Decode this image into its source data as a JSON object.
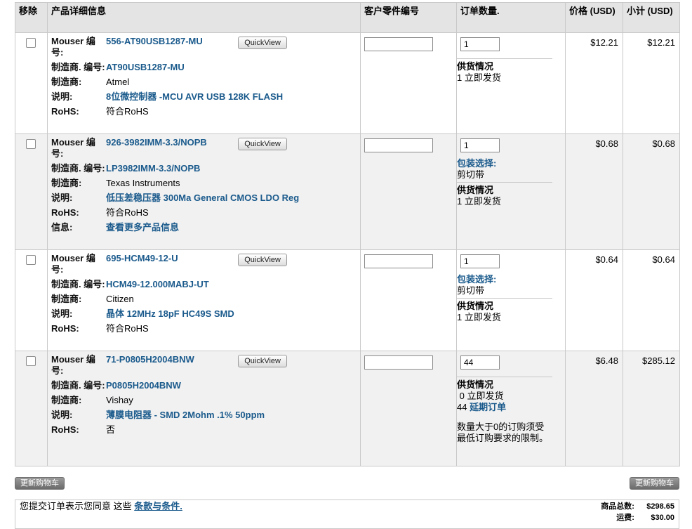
{
  "headers": {
    "remove": "移除",
    "details": "产品详细信息",
    "customer_part": "客户零件编号",
    "quantity": "订单数量.",
    "price": "价格 (USD)",
    "subtotal": "小计 (USD)"
  },
  "labels": {
    "mouser_no": "Mouser 编号:",
    "mfr_no": "制造商. 编号:",
    "mfr": "制造商:",
    "desc": "说明:",
    "rohs": "RoHS:",
    "info": "信息:",
    "quickview": "QuickView",
    "availability": "供货情况",
    "packaging": "包装选择:"
  },
  "items": [
    {
      "mouser_no": "556-AT90USB1287-MU",
      "mfr_no": "AT90USB1287-MU",
      "mfr": "Atmel",
      "desc": "8位微控制器 -MCU AVR USB 128K FLASH",
      "rohs": "符合RoHS",
      "customer_part": "",
      "qty": "1",
      "availability": "1 立即发货",
      "price": "$12.21",
      "subtotal": "$12.21"
    },
    {
      "mouser_no": "926-3982IMM-3.3/NOPB",
      "mfr_no": "LP3982IMM-3.3/NOPB",
      "mfr": "Texas Instruments",
      "desc": "低压差稳压器 300Ma General CMOS LDO Reg",
      "rohs": "符合RoHS",
      "info": "查看更多产品信息",
      "customer_part": "",
      "qty": "1",
      "packaging": "剪切带",
      "availability": "1 立即发货",
      "price": "$0.68",
      "subtotal": "$0.68"
    },
    {
      "mouser_no": "695-HCM49-12-U",
      "mfr_no": "HCM49-12.000MABJ-UT",
      "mfr": "Citizen",
      "desc": "晶体 12MHz 18pF HC49S SMD",
      "rohs": "符合RoHS",
      "customer_part": "",
      "qty": "1",
      "packaging": "剪切带",
      "availability": "1 立即发货",
      "price": "$0.64",
      "subtotal": "$0.64"
    },
    {
      "mouser_no": "71-P0805H2004BNW",
      "mfr_no": "P0805H2004BNW",
      "mfr": "Vishay",
      "desc": "薄膜电阻器 - SMD 2Mohm .1% 50ppm",
      "rohs": "否",
      "customer_part": "",
      "qty": "44",
      "availability_line1": " 0 立即发货",
      "availability_count": "44",
      "availability_backorder": "延期订单",
      "note": "数量大于0的订购须受最低订购要求的限制。",
      "price": "$6.48",
      "subtotal": "$285.12"
    }
  ],
  "buttons": {
    "update_left": "更新购物车",
    "update_right": "更新购物车"
  },
  "footer": {
    "terms_prefix": "您提交订单表示您同意 这些 ",
    "terms_link": "条款与条件.",
    "total_label": "商品总数:",
    "total_value": "$298.65",
    "shipping_label": "运费:",
    "shipping_value": "$30.00"
  }
}
